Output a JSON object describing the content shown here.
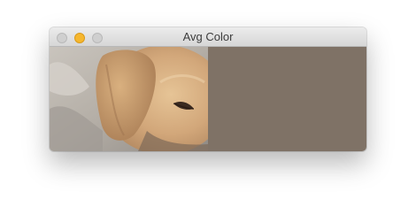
{
  "window": {
    "title": "Avg Color"
  },
  "image": {
    "subject_icon": "puppy-photo"
  },
  "average_color": {
    "hex": "#7f7266"
  }
}
